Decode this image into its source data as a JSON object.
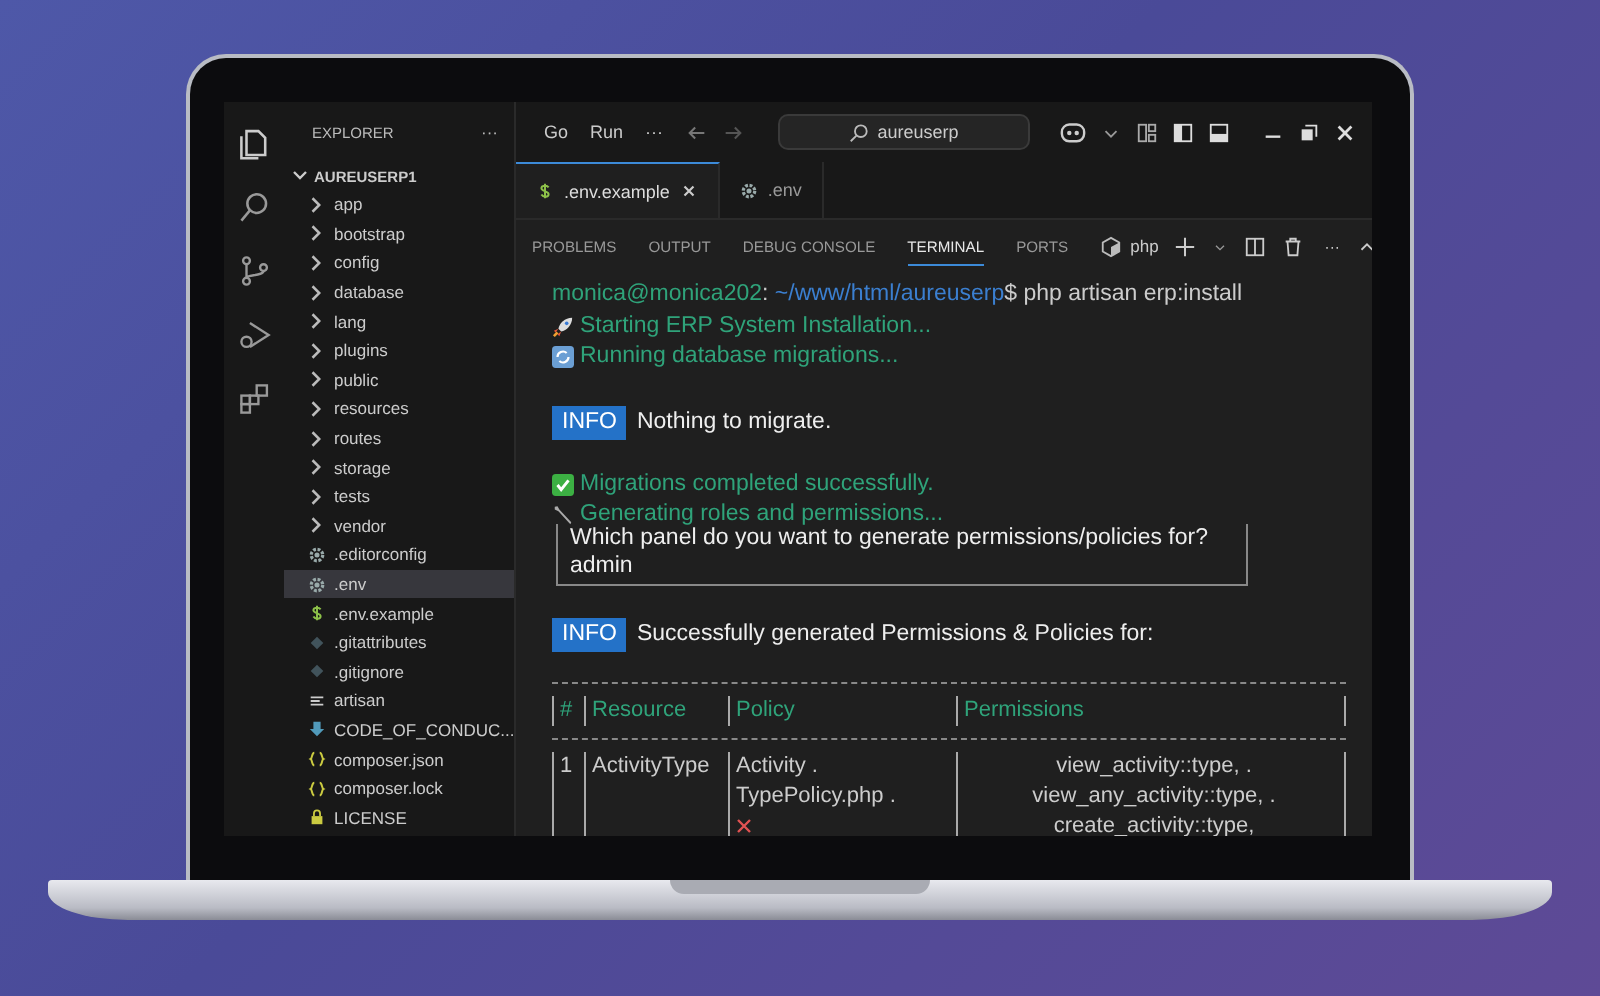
{
  "titlebar": {
    "menu": [
      "Go",
      "Run",
      "···"
    ],
    "search": "aureuserp"
  },
  "explorer": {
    "title": "EXPLORER",
    "more": "···",
    "root": {
      "label": "AUREUSERP1",
      "expanded": true,
      "children": [
        {
          "label": "app",
          "kind": "folder",
          "selected": false
        },
        {
          "label": "bootstrap",
          "kind": "folder",
          "selected": false
        },
        {
          "label": "config",
          "kind": "folder",
          "selected": false
        },
        {
          "label": "database",
          "kind": "folder",
          "selected": false
        },
        {
          "label": "lang",
          "kind": "folder",
          "selected": false
        },
        {
          "label": "plugins",
          "kind": "folder",
          "selected": false
        },
        {
          "label": "public",
          "kind": "folder",
          "selected": false
        },
        {
          "label": "resources",
          "kind": "folder",
          "selected": false
        },
        {
          "label": "routes",
          "kind": "folder",
          "selected": false
        },
        {
          "label": "storage",
          "kind": "folder",
          "selected": false
        },
        {
          "label": "tests",
          "kind": "folder",
          "selected": false
        },
        {
          "label": "vendor",
          "kind": "folder",
          "selected": false
        },
        {
          "label": ".editorconfig",
          "kind": "gear",
          "selected": false
        },
        {
          "label": ".env",
          "kind": "gear",
          "selected": true
        },
        {
          "label": ".env.example",
          "kind": "dollar",
          "selected": false
        },
        {
          "label": ".gitattributes",
          "kind": "diamond",
          "selected": false
        },
        {
          "label": ".gitignore",
          "kind": "diamond",
          "selected": false
        },
        {
          "label": "artisan",
          "kind": "lines",
          "selected": false
        },
        {
          "label": "CODE_OF_CONDUC...",
          "kind": "download",
          "selected": false
        },
        {
          "label": "composer.json",
          "kind": "braces",
          "selected": false
        },
        {
          "label": "composer.lock",
          "kind": "braces",
          "selected": false
        },
        {
          "label": "LICENSE",
          "kind": "lock",
          "selected": false
        }
      ]
    }
  },
  "editor_tabs": [
    {
      "label": ".env.example",
      "kind": "dollar",
      "selected": true
    },
    {
      "label": ".env",
      "kind": "gear",
      "selected": false
    }
  ],
  "panel_tabs": [
    {
      "label": "PROBLEMS",
      "selected": false
    },
    {
      "label": "OUTPUT",
      "selected": false
    },
    {
      "label": "DEBUG CONSOLE",
      "selected": false
    },
    {
      "label": "TERMINAL",
      "selected": true
    },
    {
      "label": "PORTS",
      "selected": false
    }
  ],
  "terminal_name": "php",
  "panel_more": "···",
  "terminal": [
    {
      "kind": "prompt",
      "user": "monica@monica202",
      "separator": ":",
      "path": "~/www/html/aureuserp",
      "command": "$ php artisan erp:install"
    },
    {
      "kind": "rocket",
      "text": "Starting ERP System Installation..."
    },
    {
      "kind": "refresh",
      "text": "Running database migrations..."
    },
    {
      "kind": "info",
      "badge": "INFO",
      "text": "Nothing to migrate."
    },
    {
      "kind": "check",
      "text": "Migrations completed successfully."
    },
    {
      "kind": "wrench",
      "text": "Generating roles and permissions..."
    },
    {
      "kind": "question",
      "label": "Which panel do you want to generate permissions/policies for?",
      "value": "admin"
    },
    {
      "kind": "info",
      "badge": "INFO",
      "text": "Successfully generated Permissions & Policies for:"
    },
    {
      "kind": "table",
      "columns": [
        "#",
        "Resource",
        "Policy",
        "Permissions"
      ],
      "rows": [
        {
          "kind": "policy",
          "cells": [
            "1",
            "ActivityType",
            "Activity .",
            "view_activity::type, ."
          ]
        },
        {
          "kind": "policy",
          "cells": [
            "",
            "",
            "TypePolicy.php  .",
            "view_any_activity::type,  ."
          ]
        },
        {
          "kind": "failed",
          "cells": [
            "",
            "",
            "",
            "create_activity::type,"
          ]
        }
      ]
    }
  ]
}
